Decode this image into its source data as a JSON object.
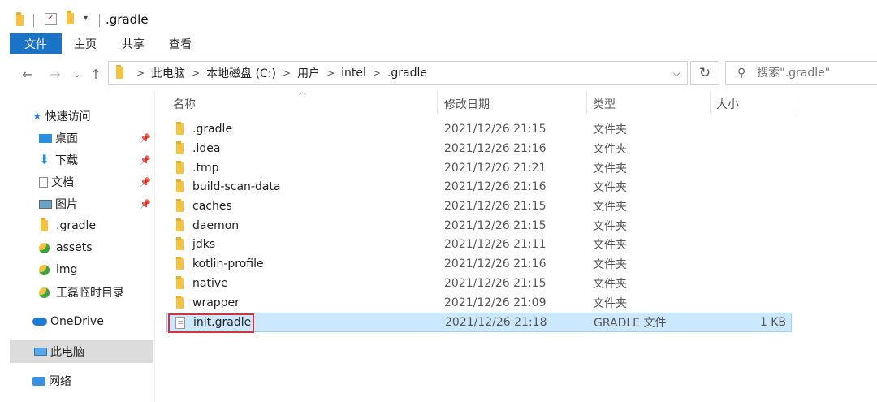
{
  "window": {
    "title": ".gradle"
  },
  "ribbon": {
    "tabs": [
      "文件",
      "主页",
      "共享",
      "查看"
    ]
  },
  "address": {
    "crumbs": [
      "此电脑",
      "本地磁盘 (C:)",
      "用户",
      "intel",
      ".gradle"
    ],
    "search_placeholder": "搜索\".gradle\""
  },
  "sidebar": {
    "quick_access": "快速访问",
    "items": [
      {
        "label": "桌面",
        "icon": "desktop-icon",
        "pinned": true
      },
      {
        "label": "下载",
        "icon": "download-icon",
        "pinned": true
      },
      {
        "label": "文档",
        "icon": "document-icon",
        "pinned": true
      },
      {
        "label": "图片",
        "icon": "pictures-icon",
        "pinned": true
      },
      {
        "label": ".gradle",
        "icon": "folder-icon",
        "pinned": false
      },
      {
        "label": "assets",
        "icon": "folder-green-icon",
        "pinned": false
      },
      {
        "label": "img",
        "icon": "folder-green-icon",
        "pinned": false
      },
      {
        "label": "王磊临时目录",
        "icon": "folder-green-icon",
        "pinned": false
      }
    ],
    "onedrive": "OneDrive",
    "this_pc": "此电脑",
    "network": "网络"
  },
  "columns": {
    "name": "名称",
    "modified": "修改日期",
    "type": "类型",
    "size": "大小"
  },
  "files": [
    {
      "name": ".gradle",
      "modified": "2021/12/26 21:15",
      "type": "文件夹",
      "size": ""
    },
    {
      "name": ".idea",
      "modified": "2021/12/26 21:16",
      "type": "文件夹",
      "size": ""
    },
    {
      "name": ".tmp",
      "modified": "2021/12/26 21:21",
      "type": "文件夹",
      "size": ""
    },
    {
      "name": "build-scan-data",
      "modified": "2021/12/26 21:16",
      "type": "文件夹",
      "size": ""
    },
    {
      "name": "caches",
      "modified": "2021/12/26 21:15",
      "type": "文件夹",
      "size": ""
    },
    {
      "name": "daemon",
      "modified": "2021/12/26 21:15",
      "type": "文件夹",
      "size": ""
    },
    {
      "name": "jdks",
      "modified": "2021/12/26 21:11",
      "type": "文件夹",
      "size": ""
    },
    {
      "name": "kotlin-profile",
      "modified": "2021/12/26 21:16",
      "type": "文件夹",
      "size": ""
    },
    {
      "name": "native",
      "modified": "2021/12/26 21:15",
      "type": "文件夹",
      "size": ""
    },
    {
      "name": "wrapper",
      "modified": "2021/12/26 21:09",
      "type": "文件夹",
      "size": ""
    },
    {
      "name": "init.gradle",
      "modified": "2021/12/26 21:18",
      "type": "GRADLE 文件",
      "size": "1 KB"
    }
  ],
  "colors": {
    "accent": "#1a73c7",
    "selection": "#cce8ff",
    "highlight": "#d9303a"
  }
}
